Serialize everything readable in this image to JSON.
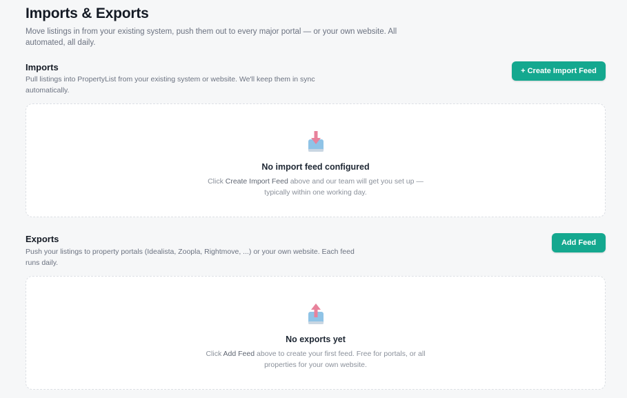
{
  "page": {
    "title": "Imports & Exports",
    "subtitle": "Move listings in from your existing system, push them out to every major portal — or your own website. All automated, all daily."
  },
  "imports": {
    "title": "Imports",
    "description": "Pull listings into PropertyList from your existing system or website. We'll keep them in sync automatically.",
    "button_label": "+ Create Import Feed",
    "empty": {
      "icon": "inbox-download-icon",
      "title": "No import feed configured",
      "desc_pre": "Click ",
      "desc_highlight": "Create Import Feed",
      "desc_post": " above and our team will get you set up — typically within one working day."
    }
  },
  "exports": {
    "title": "Exports",
    "description": "Push your listings to property portals (Idealista, Zoopla, Rightmove, ...) or your own website. Each feed runs daily.",
    "button_label": "Add Feed",
    "empty": {
      "icon": "outbox-upload-icon",
      "title": "No exports yet",
      "desc_pre": "Click ",
      "desc_highlight": "Add Feed",
      "desc_post": " above to create your first feed. Free for portals, or all properties for your own website."
    }
  },
  "colors": {
    "accent": "#14a88f",
    "background": "#f6f7f8",
    "arrow": "#e8829b",
    "tray": "#8fc3e6"
  }
}
